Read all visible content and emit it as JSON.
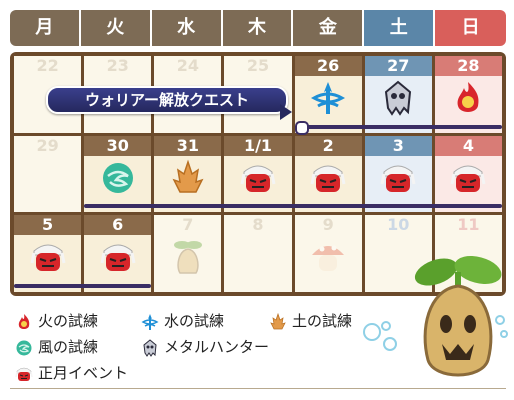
{
  "weekdays": [
    {
      "label": "月",
      "color": "#7d6b55"
    },
    {
      "label": "火",
      "color": "#7d6b55"
    },
    {
      "label": "水",
      "color": "#7d6b55"
    },
    {
      "label": "木",
      "color": "#7d6b55"
    },
    {
      "label": "金",
      "color": "#7d6b55"
    },
    {
      "label": "土",
      "color": "#5b86a8"
    },
    {
      "label": "日",
      "color": "#d95f5b"
    }
  ],
  "weeks": [
    [
      {
        "day": "22",
        "style": "faded",
        "icon": ""
      },
      {
        "day": "23",
        "style": "faded",
        "icon": ""
      },
      {
        "day": "24",
        "style": "faded",
        "icon": ""
      },
      {
        "day": "25",
        "style": "faded",
        "icon": ""
      },
      {
        "day": "26",
        "style": "active",
        "icon": "water-trial-icon"
      },
      {
        "day": "27",
        "style": "active",
        "icon": "metal-hunter-icon"
      },
      {
        "day": "28",
        "style": "active",
        "icon": "fire-trial-icon"
      }
    ],
    [
      {
        "day": "29",
        "style": "faded",
        "icon": ""
      },
      {
        "day": "30",
        "style": "active",
        "icon": "wind-trial-icon"
      },
      {
        "day": "31",
        "style": "active",
        "icon": "earth-trial-icon"
      },
      {
        "day": "1/1",
        "style": "active",
        "icon": "new-year-event-icon"
      },
      {
        "day": "2",
        "style": "active",
        "icon": "new-year-event-icon"
      },
      {
        "day": "3",
        "style": "active",
        "icon": "new-year-event-icon"
      },
      {
        "day": "4",
        "style": "active",
        "icon": "new-year-event-icon"
      }
    ],
    [
      {
        "day": "5",
        "style": "active",
        "icon": "new-year-event-icon"
      },
      {
        "day": "6",
        "style": "active",
        "icon": "new-year-event-icon"
      },
      {
        "day": "7",
        "style": "faded",
        "icon": "sprout-mascot-icon"
      },
      {
        "day": "8",
        "style": "faded",
        "icon": ""
      },
      {
        "day": "9",
        "style": "faded",
        "icon": "mushroom-mascot-icon"
      },
      {
        "day": "10",
        "style": "faded",
        "icon": ""
      },
      {
        "day": "11",
        "style": "faded",
        "icon": ""
      }
    ]
  ],
  "banner": {
    "label": "ウォリアー解放クエスト"
  },
  "legend": [
    {
      "icon": "fire-trial-icon",
      "label": "火の試練"
    },
    {
      "icon": "water-trial-icon",
      "label": "水の試練"
    },
    {
      "icon": "earth-trial-icon",
      "label": "土の試練"
    },
    {
      "icon": "wind-trial-icon",
      "label": "風の試練"
    },
    {
      "icon": "metal-hunter-icon",
      "label": "メタルハンター"
    },
    {
      "icon": "new-year-event-icon",
      "label": "正月イベント"
    }
  ],
  "colors": {
    "frame": "#6b4a2b",
    "bar": "#3a2d64",
    "header_brown": "#7d6b55",
    "header_blue": "#5b86a8",
    "header_red": "#d95f5b"
  }
}
